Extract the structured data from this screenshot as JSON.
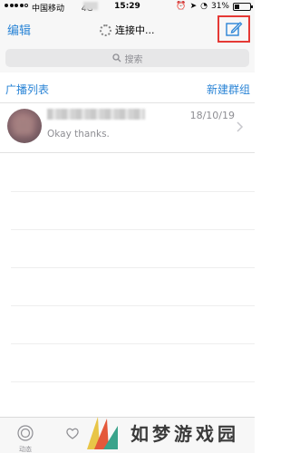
{
  "status_bar": {
    "carrier": "中国移动",
    "network": "4G",
    "time": "15:29",
    "battery": "31%",
    "battery_level": 0.31,
    "signal_bars": 4
  },
  "nav": {
    "edit_label": "编辑",
    "title": "连接中...",
    "compose_icon": "compose-icon",
    "highlight_color": "#e53935"
  },
  "search": {
    "placeholder": "搜索"
  },
  "list_header": {
    "left_label": "广播列表",
    "right_label": "新建群组"
  },
  "chats": [
    {
      "date": "18/10/19",
      "message": "Okay thanks."
    }
  ],
  "tabbar": {
    "items": [
      {
        "label": "动态",
        "icon": "status-icon"
      },
      {
        "label": "",
        "icon": "heart-icon"
      }
    ]
  },
  "watermark": {
    "text": "如梦游戏园"
  },
  "colors": {
    "accent": "#2a84d6",
    "bar_bg": "#f7f7f7",
    "search_bg": "#e7e7e8",
    "secondary_text": "#8e8e93"
  }
}
